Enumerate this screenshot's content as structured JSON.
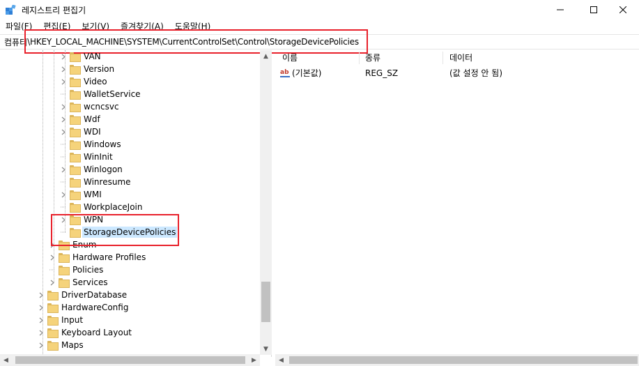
{
  "window": {
    "title": "레지스트리 편집기",
    "app_icon": "regedit-icon"
  },
  "menu": [
    {
      "label": "파일(F)"
    },
    {
      "label": "편집(E)"
    },
    {
      "label": "보기(V)"
    },
    {
      "label": "즐겨찾기(A)"
    },
    {
      "label": "도움말(H)"
    }
  ],
  "address": {
    "prefix": "컴퓨터",
    "path": "\\HKEY_LOCAL_MACHINE\\SYSTEM\\CurrentControlSet\\Control\\StorageDevicePolicies"
  },
  "tree": [
    {
      "label": "VAN",
      "expandable": true,
      "level": 3
    },
    {
      "label": "Version",
      "expandable": true,
      "level": 3
    },
    {
      "label": "Video",
      "expandable": true,
      "level": 3
    },
    {
      "label": "WalletService",
      "expandable": false,
      "level": 3
    },
    {
      "label": "wcncsvc",
      "expandable": true,
      "level": 3
    },
    {
      "label": "Wdf",
      "expandable": true,
      "level": 3
    },
    {
      "label": "WDI",
      "expandable": true,
      "level": 3
    },
    {
      "label": "Windows",
      "expandable": false,
      "level": 3
    },
    {
      "label": "WinInit",
      "expandable": false,
      "level": 3
    },
    {
      "label": "Winlogon",
      "expandable": true,
      "level": 3
    },
    {
      "label": "Winresume",
      "expandable": false,
      "level": 3
    },
    {
      "label": "WMI",
      "expandable": true,
      "level": 3
    },
    {
      "label": "WorkplaceJoin",
      "expandable": false,
      "level": 3
    },
    {
      "label": "WPN",
      "expandable": true,
      "level": 3
    },
    {
      "label": "StorageDevicePolicies",
      "expandable": false,
      "level": 3,
      "selected": true
    },
    {
      "label": "Enum",
      "expandable": true,
      "level": 2
    },
    {
      "label": "Hardware Profiles",
      "expandable": true,
      "level": 2
    },
    {
      "label": "Policies",
      "expandable": false,
      "level": 2
    },
    {
      "label": "Services",
      "expandable": true,
      "level": 2
    },
    {
      "label": "DriverDatabase",
      "expandable": true,
      "level": 1
    },
    {
      "label": "HardwareConfig",
      "expandable": true,
      "level": 1
    },
    {
      "label": "Input",
      "expandable": true,
      "level": 1
    },
    {
      "label": "Keyboard Layout",
      "expandable": true,
      "level": 1
    },
    {
      "label": "Maps",
      "expandable": true,
      "level": 1
    }
  ],
  "values": {
    "columns": {
      "name": "이름",
      "type": "종류",
      "data": "데이터"
    },
    "rows": [
      {
        "name": "(기본값)",
        "type": "REG_SZ",
        "data": "(값 설정 안 됨)",
        "icon": "string-value-icon"
      }
    ]
  },
  "colors": {
    "highlight_box": "#e8202a",
    "selection": "#cce8ff",
    "folder": "#f5d37b"
  }
}
